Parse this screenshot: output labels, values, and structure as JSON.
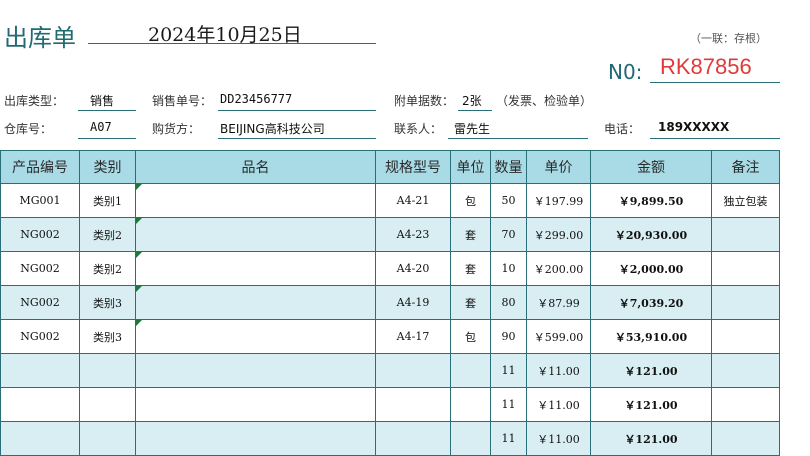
{
  "header": {
    "title": "出库单",
    "date": "2024年10月25日",
    "copy_note": "（一联：存根）",
    "no_label": "N0:",
    "no_value": "RK87856"
  },
  "info": {
    "type_label": "出库类型：",
    "type_value": "销售",
    "sale_no_label": "销售单号：",
    "sale_no_value": "DD23456777",
    "attach_label": "附单据数：",
    "attach_value": "2张",
    "attach_note": "（发票、检验单）",
    "warehouse_label": "仓库号：",
    "warehouse_value": "A07",
    "buyer_label": "购货方：",
    "buyer_value": "BEIJING高科技公司",
    "contact_label": "联系人：",
    "contact_value": "雷先生",
    "phone_label": "电话：",
    "phone_value": "189XXXXX"
  },
  "table": {
    "headers": [
      "产品编号",
      "类别",
      "品名",
      "规格型号",
      "单位",
      "数量",
      "单价",
      "金额",
      "备注"
    ],
    "rows": [
      {
        "code": "MG001",
        "cat": "类别1",
        "name": "",
        "spec": "A4-21",
        "unit": "包",
        "qty": "50",
        "price": "￥197.99",
        "amount": "￥9,899.50",
        "note": "独立包装"
      },
      {
        "code": "NG002",
        "cat": "类别2",
        "name": "",
        "spec": "A4-23",
        "unit": "套",
        "qty": "70",
        "price": "￥299.00",
        "amount": "￥20,930.00",
        "note": ""
      },
      {
        "code": "NG002",
        "cat": "类别2",
        "name": "",
        "spec": "A4-20",
        "unit": "套",
        "qty": "10",
        "price": "￥200.00",
        "amount": "￥2,000.00",
        "note": ""
      },
      {
        "code": "NG002",
        "cat": "类别3",
        "name": "",
        "spec": "A4-19",
        "unit": "套",
        "qty": "80",
        "price": "￥87.99",
        "amount": "￥7,039.20",
        "note": ""
      },
      {
        "code": "NG002",
        "cat": "类别3",
        "name": "",
        "spec": "A4-17",
        "unit": "包",
        "qty": "90",
        "price": "￥599.00",
        "amount": "￥53,910.00",
        "note": ""
      },
      {
        "code": "",
        "cat": "",
        "name": "",
        "spec": "",
        "unit": "",
        "qty": "11",
        "price": "￥11.00",
        "amount": "￥121.00",
        "note": ""
      },
      {
        "code": "",
        "cat": "",
        "name": "",
        "spec": "",
        "unit": "",
        "qty": "11",
        "price": "￥11.00",
        "amount": "￥121.00",
        "note": ""
      },
      {
        "code": "",
        "cat": "",
        "name": "",
        "spec": "",
        "unit": "",
        "qty": "11",
        "price": "￥11.00",
        "amount": "￥121.00",
        "note": ""
      }
    ]
  },
  "colors": {
    "accent": "#1f6a73",
    "header_bg": "#a9dbe7",
    "stripe_bg": "#d8eef3",
    "no_value": "#e03a3a"
  }
}
